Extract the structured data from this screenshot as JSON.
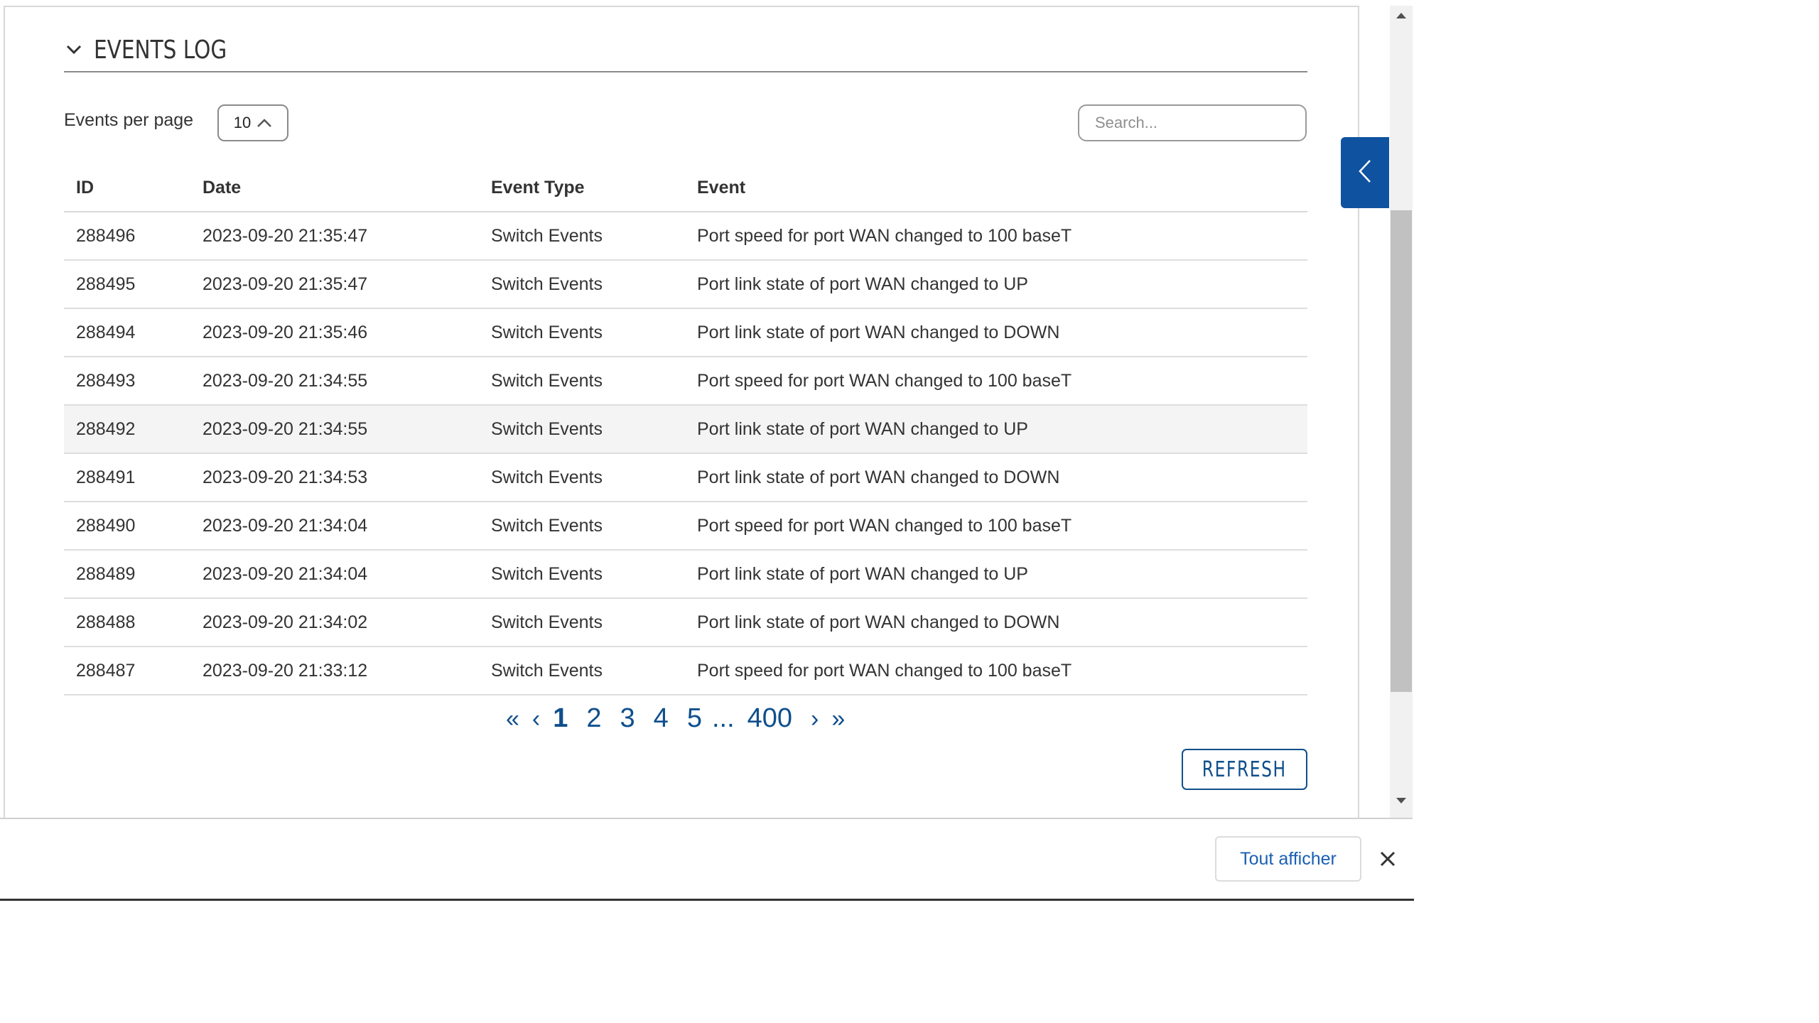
{
  "section": {
    "title": "EVENTS LOG"
  },
  "controls": {
    "per_page_label": "Events per page",
    "per_page_value": "10",
    "search_placeholder": "Search..."
  },
  "table": {
    "columns": [
      "ID",
      "Date",
      "Event Type",
      "Event"
    ],
    "rows": [
      [
        "288496",
        "2023-09-20 21:35:47",
        "Switch Events",
        "Port speed for port WAN changed to 100 baseT"
      ],
      [
        "288495",
        "2023-09-20 21:35:47",
        "Switch Events",
        "Port link state of port WAN changed to UP"
      ],
      [
        "288494",
        "2023-09-20 21:35:46",
        "Switch Events",
        "Port link state of port WAN changed to DOWN"
      ],
      [
        "288493",
        "2023-09-20 21:34:55",
        "Switch Events",
        "Port speed for port WAN changed to 100 baseT"
      ],
      [
        "288492",
        "2023-09-20 21:34:55",
        "Switch Events",
        "Port link state of port WAN changed to UP"
      ],
      [
        "288491",
        "2023-09-20 21:34:53",
        "Switch Events",
        "Port link state of port WAN changed to DOWN"
      ],
      [
        "288490",
        "2023-09-20 21:34:04",
        "Switch Events",
        "Port speed for port WAN changed to 100 baseT"
      ],
      [
        "288489",
        "2023-09-20 21:34:04",
        "Switch Events",
        "Port link state of port WAN changed to UP"
      ],
      [
        "288488",
        "2023-09-20 21:34:02",
        "Switch Events",
        "Port link state of port WAN changed to DOWN"
      ],
      [
        "288487",
        "2023-09-20 21:33:12",
        "Switch Events",
        "Port speed for port WAN changed to 100 baseT"
      ]
    ],
    "highlighted_row": 4
  },
  "pagination": {
    "first": "«",
    "prev": "‹",
    "pages": [
      "1",
      "2",
      "3",
      "4",
      "5"
    ],
    "current": "1",
    "ellipsis": "...",
    "last_page": "400",
    "next": "›",
    "last": "»"
  },
  "refresh_label": "REFRESH",
  "bottom_bar": {
    "show_all_label": "Tout afficher",
    "close_icon": "close-icon"
  },
  "colors": {
    "accent": "#0f4f8c",
    "side_tab": "#0f52a0",
    "link": "#1a5fb4"
  }
}
